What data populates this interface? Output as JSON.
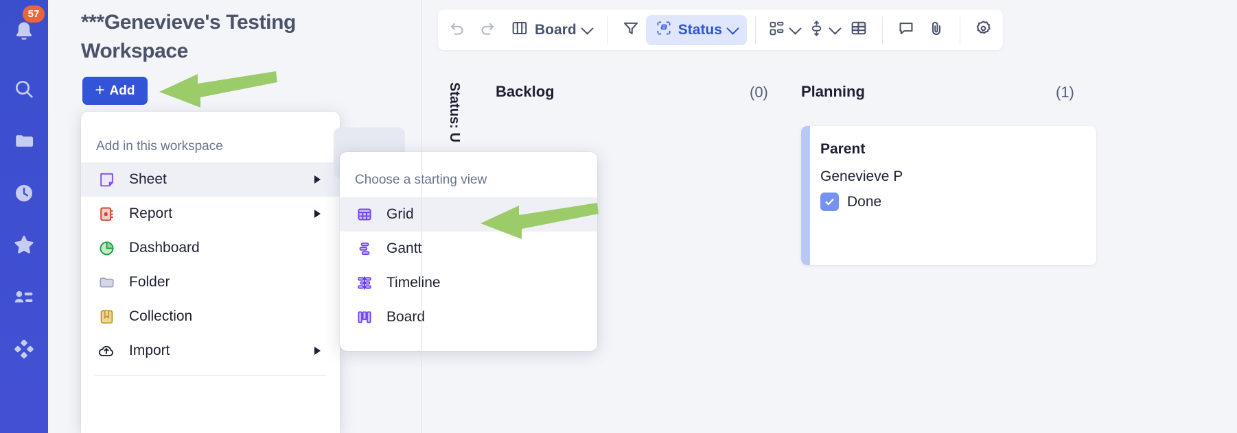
{
  "rail": {
    "items": [
      {
        "name": "notifications-icon",
        "label": "Notifications",
        "badge": "57"
      },
      {
        "name": "search-icon",
        "label": "Search"
      },
      {
        "name": "browse-folder-icon",
        "label": "Browse"
      },
      {
        "name": "recents-clock-icon",
        "label": "Recents"
      },
      {
        "name": "favorites-star-icon",
        "label": "Favorites"
      },
      {
        "name": "workspaces-people-icon",
        "label": "Workspaces"
      },
      {
        "name": "apps-grid-icon",
        "label": "Solutions"
      }
    ]
  },
  "workspace": {
    "title": "***Genevieve's Testing Workspace",
    "add_button_label": "Add",
    "add_button_plus": "+"
  },
  "add_menu": {
    "heading": "Add in this workspace",
    "items": [
      {
        "label": "Sheet",
        "icon": "sheet-icon",
        "has_submenu": true,
        "active": true
      },
      {
        "label": "Report",
        "icon": "report-icon",
        "has_submenu": true,
        "active": false
      },
      {
        "label": "Dashboard",
        "icon": "dashboard-icon",
        "has_submenu": false,
        "active": false
      },
      {
        "label": "Folder",
        "icon": "folder-icon",
        "has_submenu": false,
        "active": false
      },
      {
        "label": "Collection",
        "icon": "collection-icon",
        "has_submenu": false,
        "active": false
      },
      {
        "label": "Import",
        "icon": "import-cloud-upload-icon",
        "has_submenu": true,
        "active": false
      }
    ]
  },
  "starting_view_menu": {
    "heading": "Choose a starting view",
    "items": [
      {
        "label": "Grid",
        "icon": "grid-view-icon",
        "active": true
      },
      {
        "label": "Gantt",
        "icon": "gantt-view-icon",
        "active": false
      },
      {
        "label": "Timeline",
        "icon": "timeline-view-icon",
        "active": false
      },
      {
        "label": "Board",
        "icon": "board-view-icon",
        "active": false
      }
    ]
  },
  "toolbar": {
    "undo_label": "Undo",
    "redo_label": "Redo",
    "view_label": "Board",
    "filter_label": "Filter",
    "group_label": "Status",
    "card_layout_label": "Card layout",
    "row_height_label": "Row height",
    "table_label": "Column settings",
    "comment_label": "Conversations",
    "attach_label": "Attachments",
    "settings_label": "Settings"
  },
  "board": {
    "group_by_label": "Status: U",
    "columns": [
      {
        "title": "Backlog",
        "count": "(0)"
      },
      {
        "title": "Planning",
        "count": "(1)"
      }
    ],
    "cards": [
      {
        "title": "Parent",
        "person": "Genevieve P",
        "checkbox_label": "Done",
        "checked": true
      }
    ]
  },
  "colors": {
    "rail_blue": "#3e4fd0",
    "badge_orange": "#e8663c",
    "add_button_blue": "#3353d8",
    "accent_purple": "#6d3ff0",
    "arrow_green": "#9ccb6a",
    "status_pill_bg": "#dfe6fd",
    "status_pill_text": "#2f55d4",
    "card_accent": "#b9c7f5",
    "checkbox_blue": "#7592f0"
  }
}
